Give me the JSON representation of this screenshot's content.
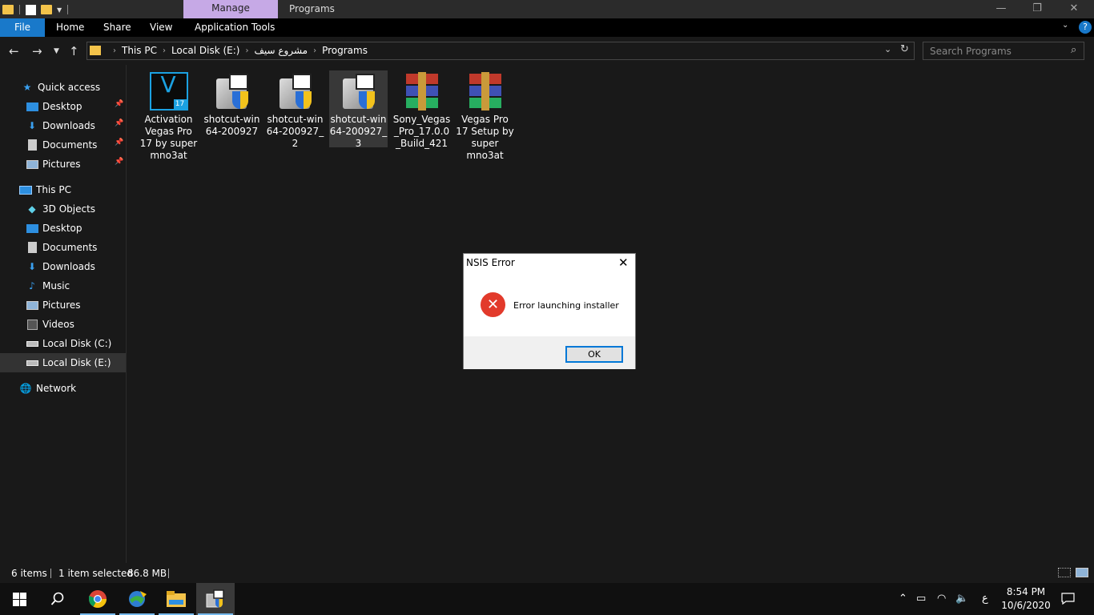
{
  "window": {
    "context_tab": "Manage",
    "title": "Programs",
    "minimize": "—",
    "restore": "❐",
    "close": "✕"
  },
  "ribbon": {
    "tabs": [
      "File",
      "Home",
      "Share",
      "View",
      "Application Tools"
    ],
    "collapse": "⌄",
    "help": "?"
  },
  "address": {
    "breadcrumbs": [
      "This PC",
      "Local Disk (E:)",
      "مشروع سيف",
      "Programs"
    ],
    "search_placeholder": "Search Programs"
  },
  "nav_pane": {
    "quick_access": "Quick access",
    "quick_items": [
      "Desktop",
      "Downloads",
      "Documents",
      "Pictures"
    ],
    "this_pc": "This PC",
    "pc_items": [
      "3D Objects",
      "Desktop",
      "Documents",
      "Downloads",
      "Music",
      "Pictures",
      "Videos",
      "Local Disk (C:)",
      "Local Disk (E:)"
    ],
    "network": "Network"
  },
  "files": [
    {
      "name": "Activation Vegas Pro 17 by super mno3at",
      "icon": "vegas-icon",
      "badge": "17"
    },
    {
      "name": "shotcut-win64-200927",
      "icon": "installer-icon"
    },
    {
      "name": "shotcut-win64-200927_2",
      "icon": "installer-icon"
    },
    {
      "name": "shotcut-win64-200927_3",
      "icon": "installer-icon",
      "selected": true
    },
    {
      "name": "Sony_Vegas_Pro_17.0.0_Build_421",
      "icon": "winrar-archive-icon"
    },
    {
      "name": "Vegas Pro 17 Setup by super mno3at",
      "icon": "winrar-archive-icon"
    }
  ],
  "dialog": {
    "title": "NSIS Error",
    "message": "Error launching installer",
    "ok": "OK"
  },
  "status": {
    "count": "6 items",
    "selection": "1 item selected",
    "size": "86.8 MB"
  },
  "taskbar": {
    "ime": "ع",
    "time": "8:54 PM",
    "date": "10/6/2020"
  },
  "colors": {
    "accent": "#1979ca",
    "manage_tab": "#c6a9e6",
    "folder": "#f3c34a",
    "error": "#e23a2b"
  }
}
